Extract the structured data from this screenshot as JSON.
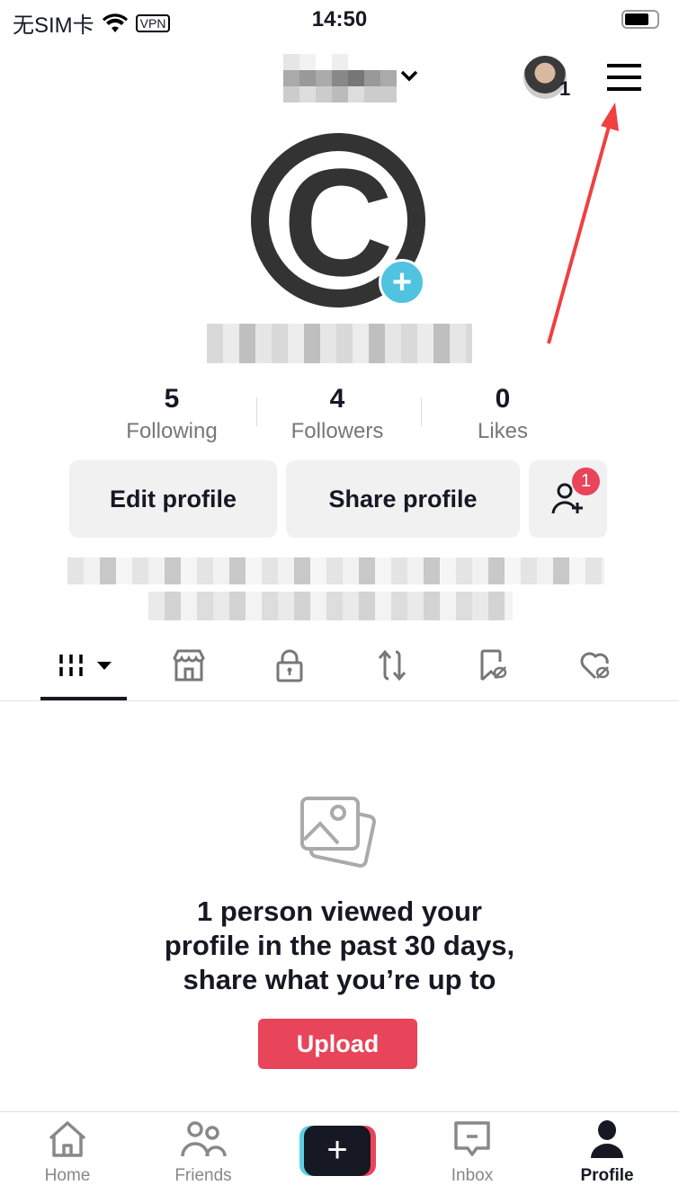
{
  "status_bar": {
    "carrier": "无SIM卡",
    "vpn": "VPN",
    "time": "14:50"
  },
  "header": {
    "notification_count": "1"
  },
  "profile": {
    "avatar_letter": "C"
  },
  "stats": [
    {
      "value": "5",
      "label": "Following"
    },
    {
      "value": "4",
      "label": "Followers"
    },
    {
      "value": "0",
      "label": "Likes"
    }
  ],
  "buttons": {
    "edit": "Edit profile",
    "share": "Share profile",
    "add_friends_badge": "1"
  },
  "tabs": [
    "videos-grid-icon",
    "shop-icon",
    "lock-icon",
    "repost-icon",
    "bookmark-hidden-icon",
    "liked-hidden-icon"
  ],
  "empty_state": {
    "lines": [
      "1 person viewed your",
      "profile in the past 30 days,",
      "share what you’re up to"
    ],
    "upload": "Upload"
  },
  "colors": {
    "accent": "#e8445a",
    "badge": "#4fc3e0",
    "annotation": "#f04040"
  },
  "nav": [
    {
      "label": "Home"
    },
    {
      "label": "Friends"
    },
    {
      "label": "Inbox"
    },
    {
      "label": "Profile"
    }
  ]
}
